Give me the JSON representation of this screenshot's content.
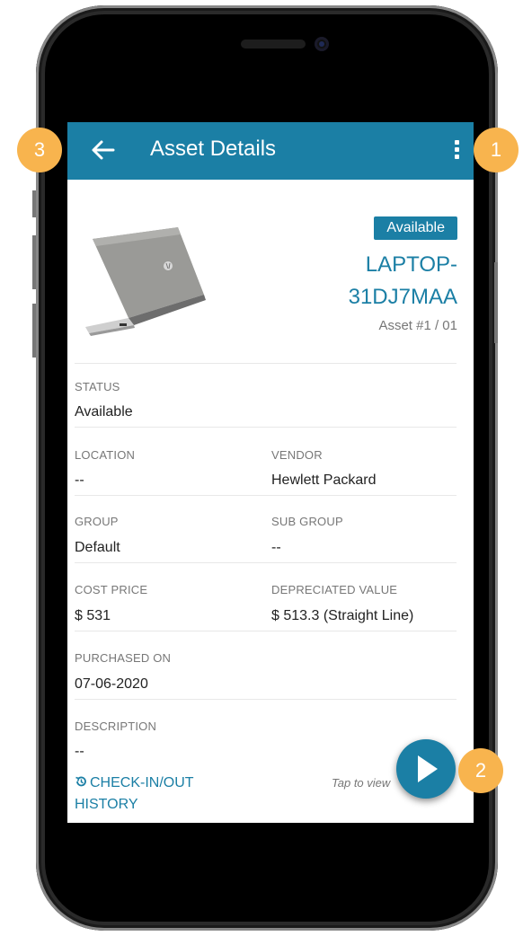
{
  "app_bar": {
    "title": "Asset Details",
    "back_icon": "arrow-left-icon",
    "menu_icon": "more-vertical-icon"
  },
  "asset": {
    "status_badge": "Available",
    "name_line1": "LAPTOP-",
    "name_line2": "31DJ7MAA",
    "number": "Asset #1 / 01",
    "image": "laptop-image"
  },
  "fields": {
    "status": {
      "label": "STATUS",
      "value": "Available"
    },
    "location": {
      "label": "LOCATION",
      "value": "--"
    },
    "vendor": {
      "label": "VENDOR",
      "value": "Hewlett Packard"
    },
    "group": {
      "label": "GROUP",
      "value": "Default"
    },
    "sub_group": {
      "label": "SUB GROUP",
      "value": "--"
    },
    "cost_price": {
      "label": "COST PRICE",
      "value": "$ 531"
    },
    "depreciated_value": {
      "label": "DEPRECIATED VALUE",
      "value": "$ 513.3 (Straight Line)"
    },
    "purchased_on": {
      "label": "PURCHASED ON",
      "value": "07-06-2020"
    },
    "description": {
      "label": "DESCRIPTION",
      "value": "--"
    }
  },
  "history": {
    "line1": "CHECK-IN/OUT",
    "line2": "HISTORY",
    "icon": "history-icon"
  },
  "hint": {
    "text": "Tap to view"
  },
  "fab": {
    "icon": "play-icon"
  },
  "callouts": {
    "one": "1",
    "two": "2",
    "three": "3"
  },
  "colors": {
    "primary": "#1b7fa5",
    "callout": "#f8b44e"
  }
}
